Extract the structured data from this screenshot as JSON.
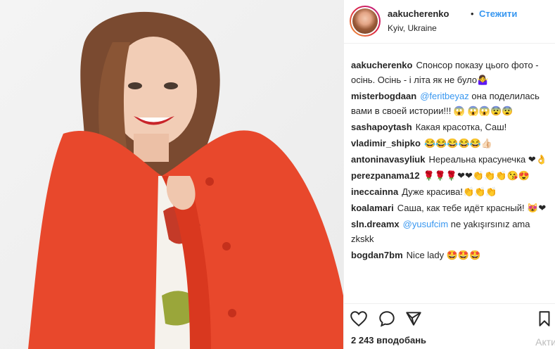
{
  "header": {
    "username": "aakucherenko",
    "separator": "•",
    "follow_label": "Стежити",
    "location": "Kyiv, Ukraine"
  },
  "comments": [
    {
      "user": "aakucherenko",
      "mention": "",
      "text": "Спонсор показу цього фото - осінь. Осінь - і літа як не було🤷‍♀️"
    },
    {
      "user": "misterbogdaan",
      "mention": "@feritbeyaz",
      "text": " она поделилась вами в своей истории!!! 😱 😱😱😨😨"
    },
    {
      "user": "sashapoytash",
      "mention": "",
      "text": "Какая красотка, Саш!"
    },
    {
      "user": "vladimir_shipko",
      "mention": "",
      "text": "😂😂😂😂😂👍🏻"
    },
    {
      "user": "antoninavasyliuk",
      "mention": "",
      "text": "Нереальна красунечка ❤👌"
    },
    {
      "user": "perezpanama12",
      "mention": "",
      "text": "🌹🌹🌹❤❤👏👏👏😘😍"
    },
    {
      "user": "ineccainna",
      "mention": "",
      "text": "Дуже красива!👏👏👏"
    },
    {
      "user": "koalamari",
      "mention": "",
      "text": "Саша, как тебе идёт красный! 😻❤"
    },
    {
      "user": "sln.dreamx",
      "mention": "@yusufcim",
      "text": " ne yakışırsınız ama zkskk"
    },
    {
      "user": "bogdan7bm",
      "mention": "",
      "text": "Nice lady 🤩🤩🤩"
    }
  ],
  "footer": {
    "likes": "2 243 вподобань",
    "activate": "Акти"
  },
  "icons": [
    "heart-icon",
    "comment-icon",
    "share-icon",
    "bookmark-icon"
  ],
  "colors": {
    "link": "#3897f0",
    "text": "#262626",
    "coat": "#e8482c"
  }
}
